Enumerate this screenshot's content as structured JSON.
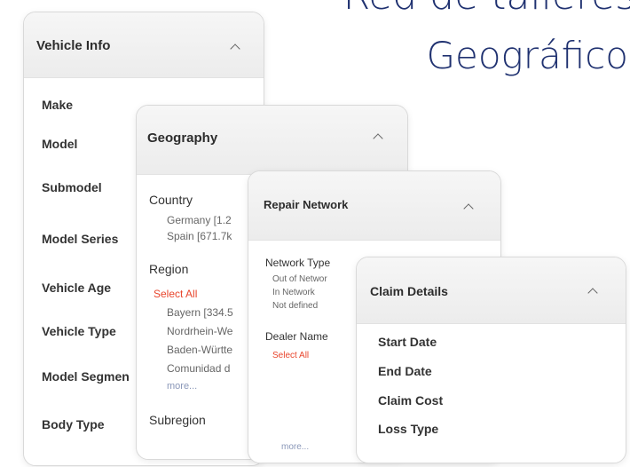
{
  "headline": {
    "line1": "Red de talleres",
    "line2": "Geográfico"
  },
  "vehicle_info": {
    "title": "Vehicle Info",
    "items": [
      "Make",
      "Model",
      "Submodel",
      "Model Series",
      "Vehicle Age",
      "Vehicle Type",
      "Model Segmen",
      "Body Type"
    ]
  },
  "geography": {
    "title": "Geography",
    "country_label": "Country",
    "countries": [
      "Germany [1.2",
      "Spain [671.7k"
    ],
    "region_label": "Region",
    "select_all": "Select All",
    "regions": [
      "Bayern [334.5",
      "Nordrhein-We",
      "Baden-Württe",
      "Comunidad d"
    ],
    "more": "more...",
    "subregion_label": "Subregion"
  },
  "repair_network": {
    "title": "Repair Network",
    "network_type_label": "Network Type",
    "network_types": [
      "Out of Networ",
      "In Network",
      "Not defined"
    ],
    "dealer_name_label": "Dealer Name",
    "select_all": "Select All",
    "more": "more..."
  },
  "claim_details": {
    "title": "Claim Details",
    "items": [
      "Start Date",
      "End Date",
      "Claim Cost",
      "Loss Type"
    ]
  },
  "colors": {
    "headline": "#1f3170",
    "select_all": "#e8452c",
    "more_link": "#8a97b8"
  },
  "icons": {
    "collapse": "chevron-up-icon"
  }
}
